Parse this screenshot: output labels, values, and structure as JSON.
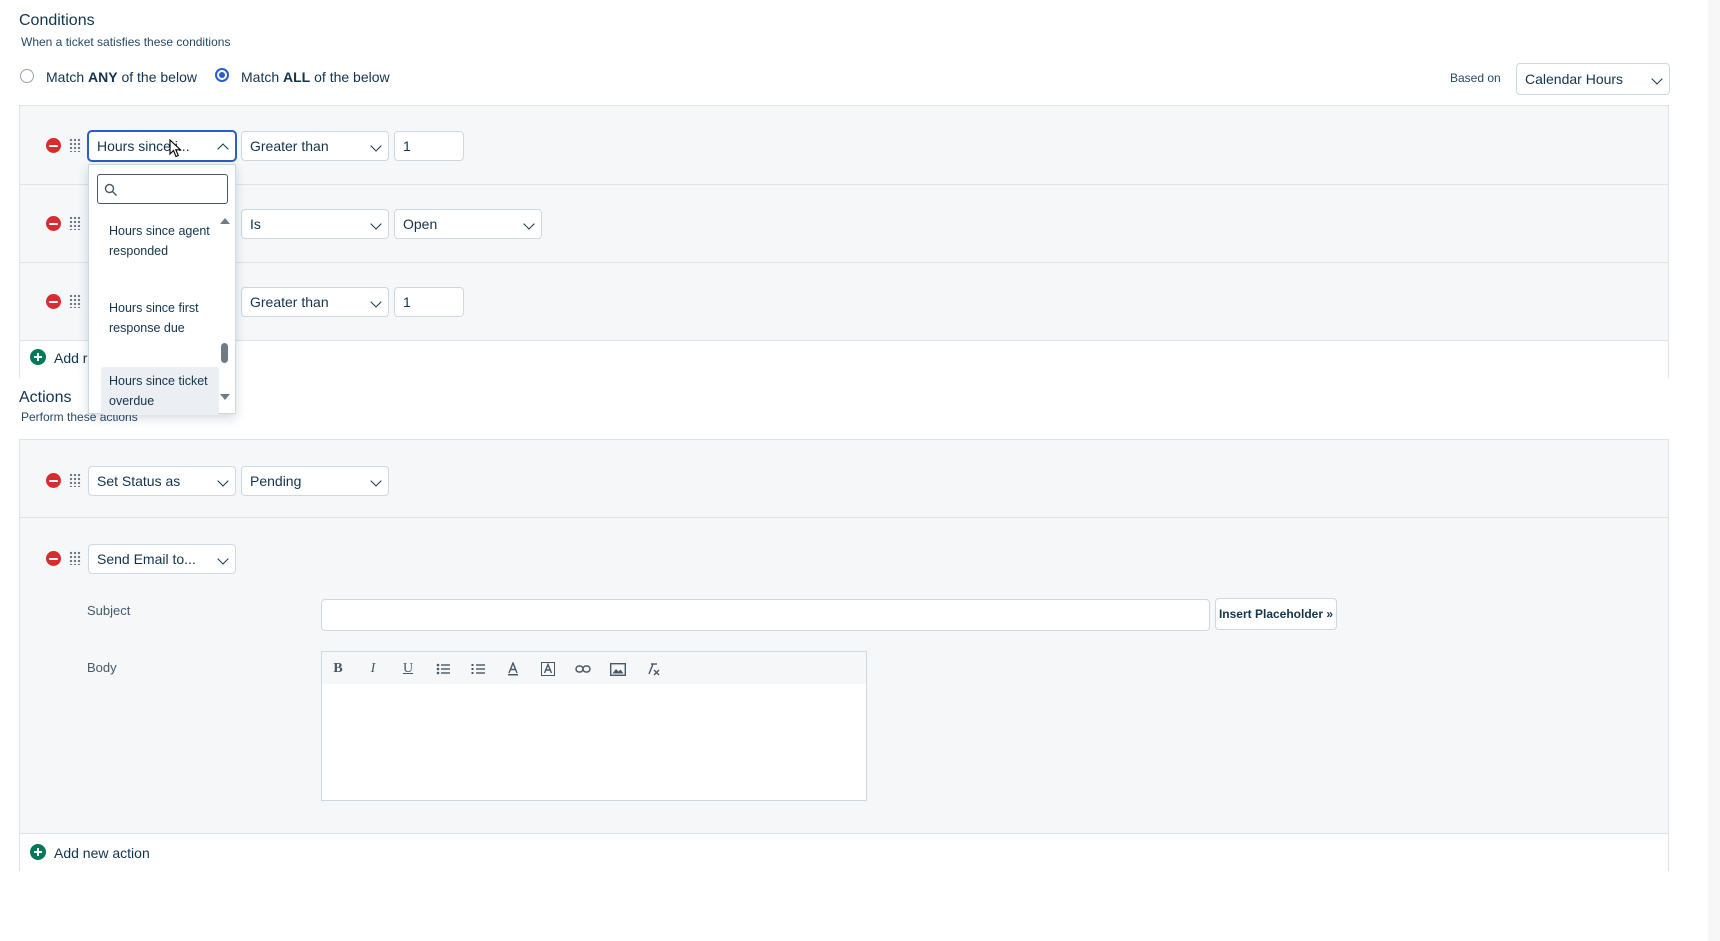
{
  "conditions": {
    "title": "Conditions",
    "subtitle": "When a ticket satisfies these conditions",
    "match_any_prefix": "Match ",
    "match_any_bold": "ANY",
    "match_any_suffix": " of the below",
    "match_all_prefix": "Match ",
    "match_all_bold": "ALL",
    "match_all_suffix": " of the below",
    "selected_match": "ALL",
    "based_on_label": "Based on",
    "based_on_value": "Calendar Hours",
    "rows": [
      {
        "field": "Hours since i...",
        "operator": "Greater than",
        "value": "1"
      },
      {
        "field": "",
        "operator": "Is",
        "value": "Open"
      },
      {
        "field": "",
        "operator": "Greater than",
        "value": "1"
      }
    ],
    "add_label_partial": "Add r"
  },
  "dropdown": {
    "search_placeholder": "",
    "options": [
      {
        "label": "Hours since agent responded"
      },
      {
        "label": "Hours since first response due"
      },
      {
        "label": "Hours since ticket overdue"
      }
    ]
  },
  "actions": {
    "title": "Actions",
    "subtitle": "Perform these actions",
    "rows": [
      {
        "action": "Set Status as",
        "value": "Pending"
      },
      {
        "action": "Send Email to..."
      }
    ],
    "subject_label": "Subject",
    "subject_value": "",
    "insert_placeholder": "Insert Placeholder »",
    "body_label": "Body",
    "toolbar": [
      "B",
      "I",
      "U"
    ],
    "add_label": "Add new action"
  },
  "colors": {
    "primary": "#2c5cc5",
    "danger": "#d72d30",
    "success": "#00795b",
    "panel_bg": "#f5f7f9"
  }
}
